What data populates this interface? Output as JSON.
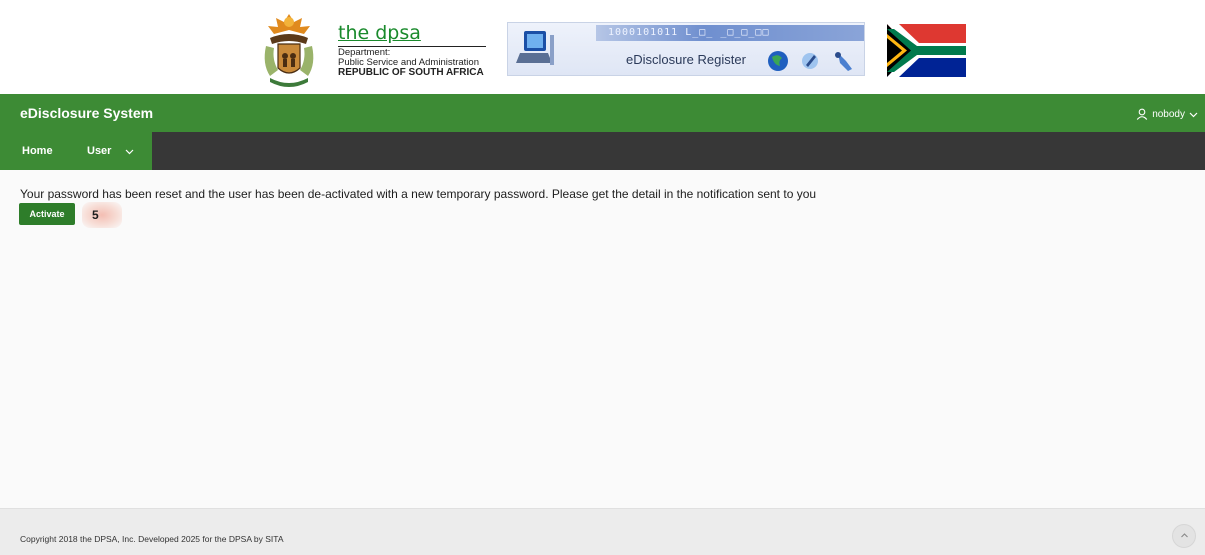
{
  "banner": {
    "dpsa_title": "the dpsa",
    "dpsa_line1": "Department:",
    "dpsa_line2": "Public Service and Administration",
    "dpsa_line3": "REPUBLIC OF SOUTH AFRICA",
    "register_digits": "1000101011 L_□_ _□_□_□□",
    "register_title": "eDisclosure Register"
  },
  "header": {
    "app_title": "eDisclosure System",
    "user_name": "nobody",
    "brand_color": "#3d8b35"
  },
  "nav": {
    "items": [
      {
        "label": "Home"
      },
      {
        "label": "User"
      }
    ]
  },
  "main": {
    "message": "Your password has been reset and the user has been de-activated with a new temporary password. Please get the detail in the notification sent to you",
    "activate_label": "Activate",
    "badge_value": "5"
  },
  "footer": {
    "copyright": "Copyright 2018 the DPSA, Inc. Developed 2025 for the DPSA by SITA"
  },
  "icons": {
    "user": "user-icon",
    "chevron": "chevron-down-icon",
    "scroll_top": "chevron-up-icon"
  }
}
